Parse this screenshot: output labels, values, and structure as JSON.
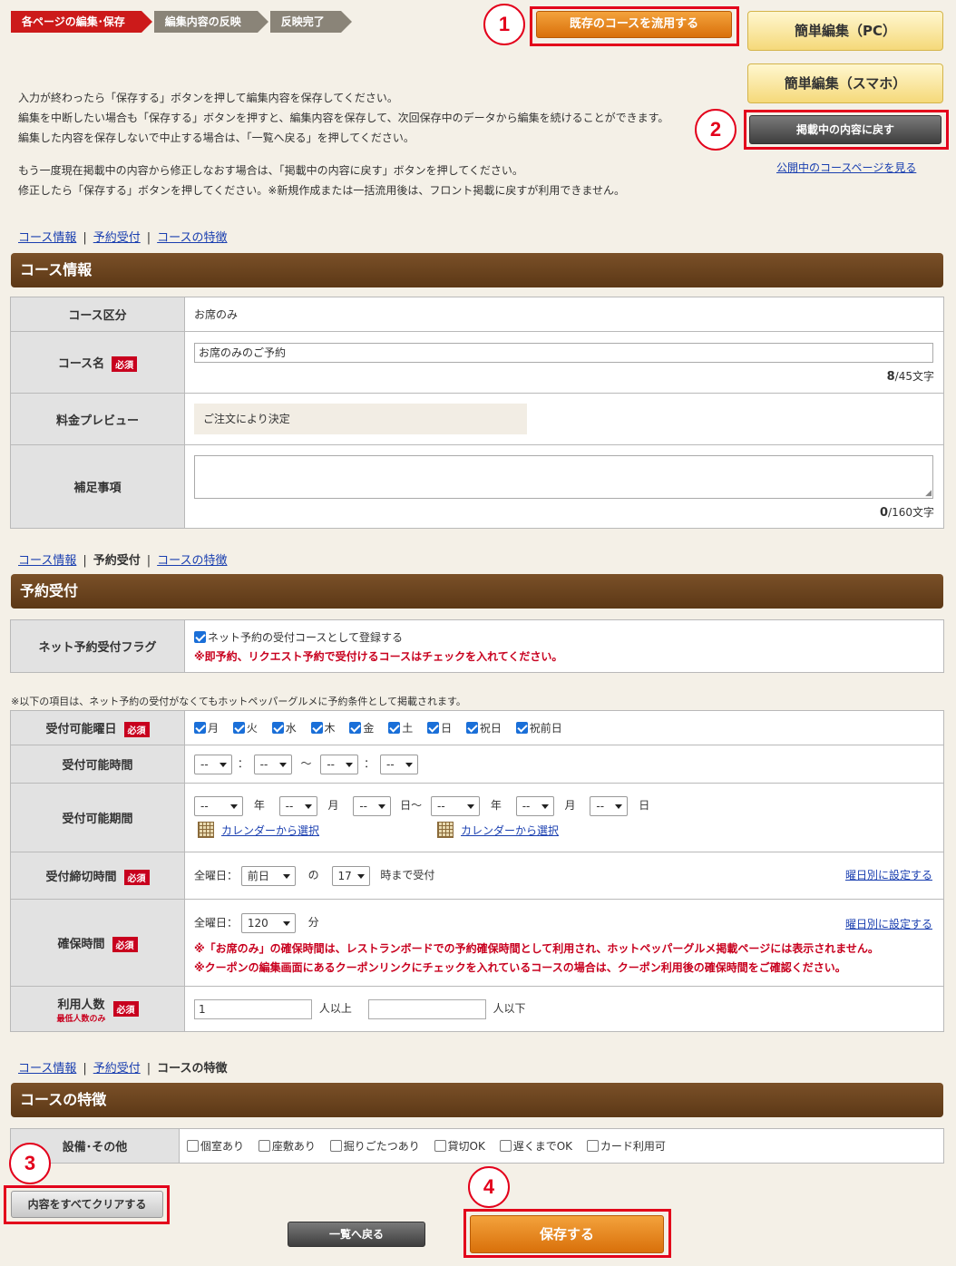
{
  "steps": [
    "各ページの編集･保存",
    "編集内容の反映",
    "反映完了"
  ],
  "buttons": {
    "reuse_course": "既存のコースを流用する",
    "easy_edit_pc": "簡単編集（PC）",
    "easy_edit_sp": "簡単編集（スマホ）",
    "revert": "掲載中の内容に戻す",
    "view_public": "公開中のコースページを見る",
    "clear_all": "内容をすべてクリアする",
    "back_list": "一覧へ戻る",
    "save": "保存する"
  },
  "callouts": [
    "1",
    "2",
    "3",
    "4"
  ],
  "intro": {
    "line1": "入力が終わったら「保存する」ボタンを押して編集内容を保存してください。",
    "line2": "編集を中断したい場合も「保存する」ボタンを押すと、編集内容を保存して、次回保存中のデータから編集を続けることができます。",
    "line3": "編集した内容を保存しないで中止する場合は、「一覧へ戻る」を押してください。",
    "line4": "もう一度現在掲載中の内容から修正しなおす場合は、「掲載中の内容に戻す」ボタンを押してください。",
    "line5": "修正したら「保存する」ボタンを押してください。※新規作成または一括流用後は、フロント掲載に戻すが利用できません。"
  },
  "tabs": {
    "course_info": "コース情報",
    "reservation": "予約受付",
    "features": "コースの特徴",
    "sep": "|"
  },
  "required": "必須",
  "course_info": {
    "title": "コース情報",
    "type_label": "コース区分",
    "type_value": "お席のみ",
    "name_label": "コース名",
    "name_value": "お席のみのご予約",
    "name_count": "8",
    "name_max": "/45文字",
    "price_label": "料金プレビュー",
    "price_value": "ご注文により決定",
    "supp_label": "補足事項",
    "supp_count": "0",
    "supp_max": "/160文字"
  },
  "reservation": {
    "title": "予約受付",
    "net_flag_label": "ネット予約受付フラグ",
    "net_flag_text": "ネット予約の受付コースとして登録する",
    "net_flag_note": "※即予約、リクエスト予約で受付けるコースはチェックを入れてください。",
    "notice": "※以下の項目は、ネット予約の受付がなくてもホットペッパーグルメに予約条件として掲載されます。",
    "days_label": "受付可能曜日",
    "days": [
      "月",
      "火",
      "水",
      "木",
      "金",
      "土",
      "日",
      "祝日",
      "祝前日"
    ],
    "time_label": "受付可能時間",
    "dash": "--",
    "colon": "：",
    "tilde": "〜",
    "period_label": "受付可能期間",
    "year": "年",
    "month": "月",
    "day": "日",
    "day_tilde": "日〜",
    "calendar": "カレンダーから選択",
    "deadline_label": "受付締切時間",
    "all_days": "全曜日：",
    "prev_day": "前日",
    "no": "の",
    "hour": "17",
    "until": "時まで受付",
    "per_day": "曜日別に設定する",
    "hold_label": "確保時間",
    "hold_value": "120",
    "minutes": "分",
    "hold_note1": "※「お席のみ」の確保時間は、レストランボードでの予約確保時間として利用され、ホットペッパーグルメ掲載ページには表示されません。",
    "hold_note2": "※クーポンの編集画面にあるクーポンリンクにチェックを入れているコースの場合は、クーポン利用後の確保時間をご確認ください。",
    "people_label": "利用人数",
    "people_sub": "最低人数のみ",
    "people_min": "1",
    "over": "人以上",
    "under": "人以下"
  },
  "features": {
    "title": "コースの特徴",
    "facility_label": "設備･その他",
    "options": [
      "個室あり",
      "座敷あり",
      "掘りごたつあり",
      "貸切OK",
      "遅くまでOK",
      "カード利用可"
    ]
  }
}
